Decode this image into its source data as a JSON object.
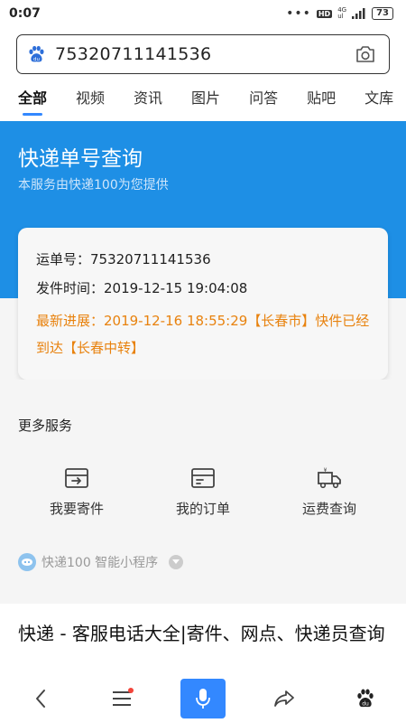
{
  "status": {
    "time": "0:07",
    "hd": "HD",
    "net_top": "4G",
    "net_bottom": "ul",
    "battery": "73"
  },
  "search": {
    "query": "75320711141536"
  },
  "tabs": [
    {
      "label": "全部"
    },
    {
      "label": "视频"
    },
    {
      "label": "资讯"
    },
    {
      "label": "图片"
    },
    {
      "label": "问答"
    },
    {
      "label": "贴吧"
    },
    {
      "label": "文库"
    }
  ],
  "header": {
    "title": "快递单号查询",
    "subtitle": "本服务由快递100为您提供"
  },
  "card": {
    "waybill": "运单号：75320711141536",
    "send_time": "发件时间：2019-12-15 19:04:08",
    "latest": "最新进展：2019-12-16 18:55:29【长春市】快件已经到达【长春中转】"
  },
  "services": {
    "title": "更多服务",
    "items": [
      {
        "label": "我要寄件",
        "icon": "send-package-icon"
      },
      {
        "label": "我的订单",
        "icon": "order-icon"
      },
      {
        "label": "运费查询",
        "icon": "truck-icon"
      }
    ],
    "mini_app": "快递100 智能小程序"
  },
  "result": {
    "title": "快递 - 客服电话大全|寄件、网点、快递员查询"
  },
  "colors": {
    "brand_blue": "#1e8fe5",
    "accent_blue": "#3388ff",
    "latest_orange": "#e8820e"
  }
}
